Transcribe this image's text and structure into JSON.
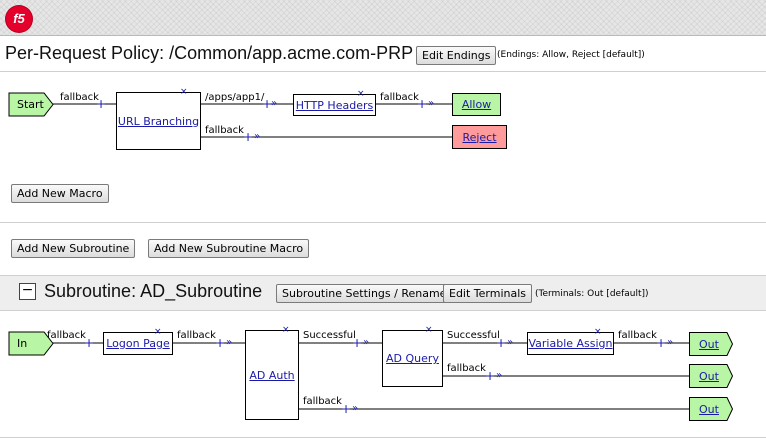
{
  "header": {
    "logo_text": "f5"
  },
  "policy": {
    "title": "Per-Request Policy: /Common/app.acme.com-PRP",
    "edit_endings_label": "Edit Endings",
    "endings_note": "(Endings: Allow, Reject [default])",
    "start_label": "Start",
    "url_branching_label": "URL Branching",
    "http_headers_label": "HTTP Headers",
    "allow_label": "Allow",
    "reject_label": "Reject",
    "branch_fallback": "fallback",
    "branch_apps": "/apps/app1/",
    "add_new_macro_label": "Add New Macro",
    "add_new_subroutine_label": "Add New Subroutine",
    "add_new_subroutine_macro_label": "Add New Subroutine Macro"
  },
  "subroutine": {
    "collapse_symbol": "−",
    "title": "Subroutine: AD_Subroutine",
    "settings_label": "Subroutine Settings / Rename",
    "edit_terminals_label": "Edit Terminals",
    "terminals_note": "(Terminals: Out [default])",
    "in_label": "In",
    "logon_page_label": "Logon Page",
    "ad_auth_label": "AD Auth",
    "ad_query_label": "AD Query",
    "variable_assign_label": "Variable Assign",
    "out_label": "Out",
    "branch_fallback": "fallback",
    "branch_successful": "Successful"
  },
  "glyphs": {
    "plus": "+",
    "chevrons": "»",
    "x": "×"
  },
  "colors": {
    "terminal_green": "#b8f5a4",
    "terminal_red": "#ff9b9b",
    "link_blue": "#1a1aa6",
    "logo_red": "#e4002b"
  }
}
